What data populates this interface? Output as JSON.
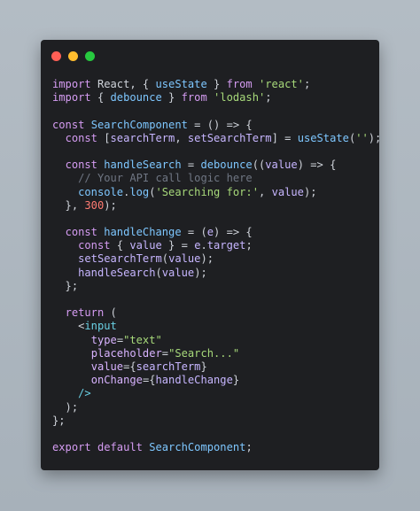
{
  "window": {
    "buttons": {
      "close_color": "#ff5f56",
      "minimize_color": "#ffbd2e",
      "maximize_color": "#27c93f"
    }
  },
  "code_lines": [
    [
      [
        "kw",
        "import"
      ],
      [
        "plain",
        " React, { "
      ],
      [
        "fn",
        "useState"
      ],
      [
        "plain",
        " } "
      ],
      [
        "kw",
        "from"
      ],
      [
        "plain",
        " "
      ],
      [
        "str",
        "'react'"
      ],
      [
        "plain",
        ";"
      ]
    ],
    [
      [
        "kw",
        "import"
      ],
      [
        "plain",
        " { "
      ],
      [
        "fn",
        "debounce"
      ],
      [
        "plain",
        " } "
      ],
      [
        "kw",
        "from"
      ],
      [
        "plain",
        " "
      ],
      [
        "str",
        "'lodash'"
      ],
      [
        "plain",
        ";"
      ]
    ],
    [],
    [
      [
        "kw",
        "const"
      ],
      [
        "plain",
        " "
      ],
      [
        "fn",
        "SearchComponent"
      ],
      [
        "plain",
        " = () => {"
      ]
    ],
    [
      [
        "plain",
        "  "
      ],
      [
        "kw",
        "const"
      ],
      [
        "plain",
        " ["
      ],
      [
        "var",
        "searchTerm"
      ],
      [
        "plain",
        ", "
      ],
      [
        "var",
        "setSearchTerm"
      ],
      [
        "plain",
        "] = "
      ],
      [
        "fn",
        "useState"
      ],
      [
        "plain",
        "("
      ],
      [
        "str",
        "''"
      ],
      [
        "plain",
        ");"
      ]
    ],
    [],
    [
      [
        "plain",
        "  "
      ],
      [
        "kw",
        "const"
      ],
      [
        "plain",
        " "
      ],
      [
        "fn",
        "handleSearch"
      ],
      [
        "plain",
        " = "
      ],
      [
        "fn",
        "debounce"
      ],
      [
        "plain",
        "(("
      ],
      [
        "var",
        "value"
      ],
      [
        "plain",
        ") => {"
      ]
    ],
    [
      [
        "plain",
        "    "
      ],
      [
        "cmt",
        "// Your API call logic here"
      ]
    ],
    [
      [
        "plain",
        "    "
      ],
      [
        "fn",
        "console"
      ],
      [
        "plain",
        "."
      ],
      [
        "fn",
        "log"
      ],
      [
        "plain",
        "("
      ],
      [
        "str",
        "'Searching for:'"
      ],
      [
        "plain",
        ", "
      ],
      [
        "var",
        "value"
      ],
      [
        "plain",
        ");"
      ]
    ],
    [
      [
        "plain",
        "  }, "
      ],
      [
        "num",
        "300"
      ],
      [
        "plain",
        ");"
      ]
    ],
    [],
    [
      [
        "plain",
        "  "
      ],
      [
        "kw",
        "const"
      ],
      [
        "plain",
        " "
      ],
      [
        "fn",
        "handleChange"
      ],
      [
        "plain",
        " = ("
      ],
      [
        "var",
        "e"
      ],
      [
        "plain",
        ") => {"
      ]
    ],
    [
      [
        "plain",
        "    "
      ],
      [
        "kw",
        "const"
      ],
      [
        "plain",
        " { "
      ],
      [
        "var",
        "value"
      ],
      [
        "plain",
        " } = "
      ],
      [
        "var",
        "e"
      ],
      [
        "plain",
        "."
      ],
      [
        "var",
        "target"
      ],
      [
        "plain",
        ";"
      ]
    ],
    [
      [
        "plain",
        "    "
      ],
      [
        "var",
        "setSearchTerm"
      ],
      [
        "plain",
        "("
      ],
      [
        "var",
        "value"
      ],
      [
        "plain",
        ");"
      ]
    ],
    [
      [
        "plain",
        "    "
      ],
      [
        "var",
        "handleSearch"
      ],
      [
        "plain",
        "("
      ],
      [
        "var",
        "value"
      ],
      [
        "plain",
        ");"
      ]
    ],
    [
      [
        "plain",
        "  };"
      ]
    ],
    [],
    [
      [
        "plain",
        "  "
      ],
      [
        "kw",
        "return"
      ],
      [
        "plain",
        " ("
      ]
    ],
    [
      [
        "plain",
        "    <"
      ],
      [
        "tag",
        "input"
      ]
    ],
    [
      [
        "plain",
        "      "
      ],
      [
        "attr",
        "type"
      ],
      [
        "plain",
        "="
      ],
      [
        "str",
        "\"text\""
      ]
    ],
    [
      [
        "plain",
        "      "
      ],
      [
        "attr",
        "placeholder"
      ],
      [
        "plain",
        "="
      ],
      [
        "str",
        "\"Search...\""
      ]
    ],
    [
      [
        "plain",
        "      "
      ],
      [
        "attr",
        "value"
      ],
      [
        "plain",
        "={"
      ],
      [
        "var",
        "searchTerm"
      ],
      [
        "plain",
        "}"
      ]
    ],
    [
      [
        "plain",
        "      "
      ],
      [
        "attr",
        "onChange"
      ],
      [
        "plain",
        "={"
      ],
      [
        "var",
        "handleChange"
      ],
      [
        "plain",
        "}"
      ]
    ],
    [
      [
        "plain",
        "    "
      ],
      [
        "tag",
        "/>"
      ]
    ],
    [
      [
        "plain",
        "  );"
      ]
    ],
    [
      [
        "plain",
        "};"
      ]
    ],
    [],
    [
      [
        "kw",
        "export"
      ],
      [
        "plain",
        " "
      ],
      [
        "kw",
        "default"
      ],
      [
        "plain",
        " "
      ],
      [
        "fn",
        "SearchComponent"
      ],
      [
        "plain",
        ";"
      ]
    ]
  ]
}
